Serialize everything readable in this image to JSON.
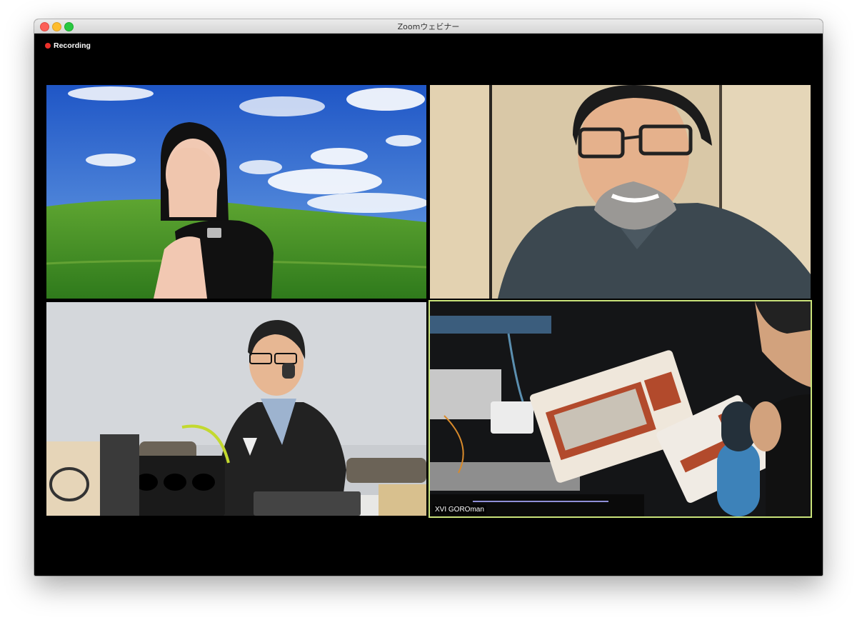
{
  "window": {
    "title": "Zoomウェビナー"
  },
  "recording": {
    "label": "Recording",
    "color": "#e9302a"
  },
  "active_speaker_color": "#c9e27a",
  "participants": [
    {
      "name": ""
    },
    {
      "name": ""
    },
    {
      "name": ""
    },
    {
      "name": "XVI GOROman",
      "active_speaker": true
    }
  ]
}
